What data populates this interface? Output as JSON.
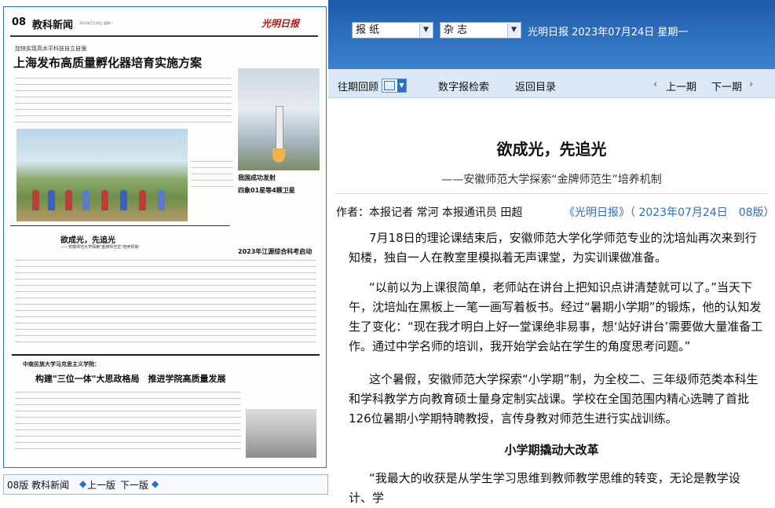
{
  "newspaper": {
    "page_number": "08",
    "section": "教科新闻",
    "masthead": "光明日报",
    "date_line": "2023年7月24日 星期一",
    "kicker": "加快实现高水平科技自立自强",
    "headline": "上海发布高质量孵化器培育实施方案",
    "photo_caption_line1": "我国成功发射",
    "photo_caption_line2": "四象01星等4颗卫星",
    "article_headline": "欲成光，先追光",
    "article_sub": "——安徽师范大学探索\"金牌师范生\"培养机制",
    "edu_headline": "2023年江源综合科考启动",
    "feature_kicker": "中南民族大学马克思主义学院：",
    "feature_headline": "构建\"三位一体\"大思政格局　推进学院高质量发展"
  },
  "bottom_bar": {
    "page_label": "08版 教科新闻",
    "prev": "上一版",
    "next": "下一版"
  },
  "top_band": {
    "select_paper": "报 纸",
    "select_magazine": "杂 志",
    "publication": "光明日报 2023年07月24日 星期一"
  },
  "nav": {
    "archive": "往期回顾",
    "digital_search": "数字报检索",
    "back_to_contents": "返回目录",
    "prev_issue": "上一期",
    "next_issue": "下一期"
  },
  "article": {
    "title": "欲成光，先追光",
    "subtitle": "——安徽师范大学探索“金牌师范生”培养机制",
    "byline": "作者：本报记者 常河 本报通讯员 田超",
    "source": "《光明日报》（ 2023年07月24日　08版）",
    "p1": "7月18日的理论课结束后，安徽师范大学化学师范专业的沈培灿再次来到行知楼，独自一人在教室里模拟着无声课堂，为实训课做准备。",
    "p2": "“以前以为上课很简单，老师站在讲台上把知识点讲清楚就可以了。”当天下午，沈培灿在黑板上一笔一画写着板书。经过“暑期小学期”的锻炼，他的认知发生了变化：“现在我才明白上好一堂课绝非易事，想‘站好讲台’需要做大量准备工作。通过中学名师的培训，我开始学会站在学生的角度思考问题。”",
    "p3": "这个暑假，安徽师范大学探索“小学期”制，为全校二、三年级师范类本科生和学科教学方向教育硕士量身定制实战课。学校在全国范围内精心选聘了首批126位暑期小学期特聘教授，言传身教对师范生进行实战训练。",
    "section_heading": "小学期撬动大改革",
    "p4": "“我最大的收获是从学生学习思维到教师教学思维的转变，无论是教学设计、学"
  },
  "colors": {
    "brand_blue": "#2a6fc4",
    "masthead_red": "#b51717"
  }
}
